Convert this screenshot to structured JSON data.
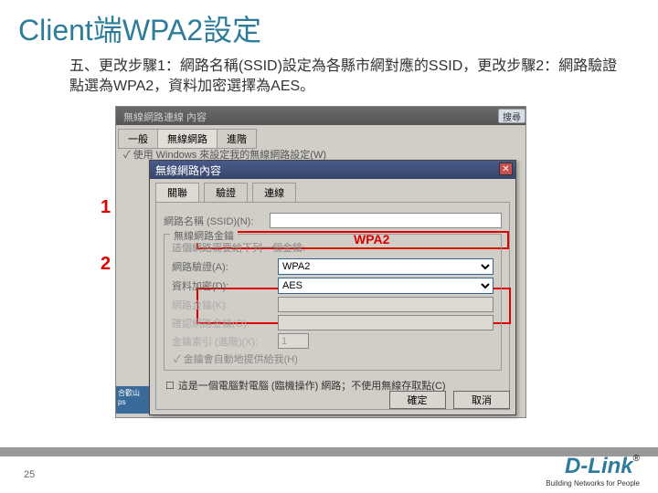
{
  "title": "Client端WPA2設定",
  "instruction": "五、更改步驟1：網路名稱(SSID)設定為各縣市網對應的SSID，更改步驟2：網路驗證點選為WPA2，資料加密選擇為AES。",
  "marks": {
    "one": "1",
    "two": "2"
  },
  "bg": {
    "title": "無線網路連線 內容",
    "tabs": [
      "一般",
      "無線網路",
      "進階"
    ],
    "chk": "✓ 使用 Windows 來設定我的無線網路設定(W)",
    "search": "搜尋"
  },
  "dlg": {
    "title": "無線網路內容",
    "close": "✕",
    "tabs": [
      "關聯",
      "驗證",
      "連線"
    ],
    "ssid_label": "網路名稱 (SSID)(N):",
    "ssid_overlay": "WPA2",
    "group_title": "無線網路金鑰",
    "group_desc": "這個網路需要給下列一個金鑰:",
    "auth_label": "網路驗證(A):",
    "auth_value": "WPA2",
    "enc_label": "資料加密(D):",
    "enc_value": "AES",
    "key_label": "網路金鑰(K):",
    "key_confirm": "確認網路金鑰(O):",
    "key_idx_label": "金鑰索引 (進階)(X):",
    "key_idx_value": "1",
    "auto_key": "✓ 金鑰會自動地提供給我(H)",
    "adhoc_chk": "☐",
    "adhoc": "這是一個電腦對電腦 (臨機操作) 網路；不使用無線存取點(C)",
    "ok": "確定",
    "cancel": "取消"
  },
  "taskicon": "合歡山\nps",
  "page": "25",
  "logo": "D-Link",
  "logo_r": "®",
  "logo_sub": "Building Networks for People"
}
